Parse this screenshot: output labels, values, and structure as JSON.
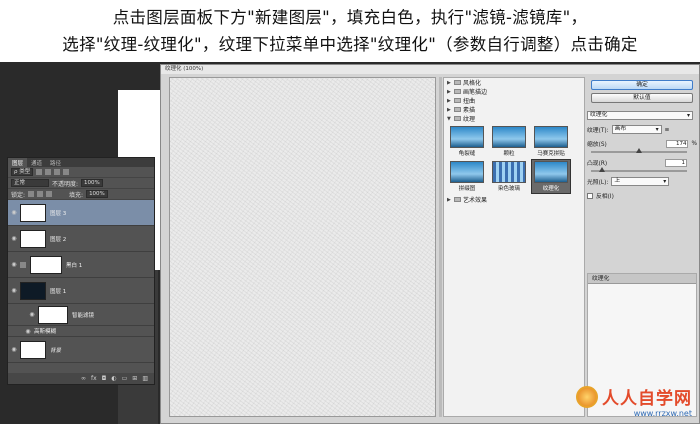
{
  "caption": {
    "line1": "点击图层面板下方\"新建图层\"，填充白色，执行\"滤镜-滤镜库\"，",
    "line2": "选择\"纹理-纹理化\"，纹理下拉菜单中选择\"纹理化\"（参数自行调整）点击确定"
  },
  "layers_panel": {
    "tabs": [
      "图层",
      "通道",
      "路径"
    ],
    "filter_kind": "ρ 类型",
    "blend_mode": "正常",
    "opacity_label": "不透明度:",
    "opacity_value": "100%",
    "lock_label": "锁定:",
    "fill_label": "填充:",
    "fill_value": "100%",
    "layers": [
      {
        "name": "图层 3",
        "selected": true,
        "thumb": "white"
      },
      {
        "name": "图层 2",
        "selected": false,
        "thumb": "white"
      },
      {
        "name": "黑白 1",
        "selected": false,
        "thumb": "mask"
      },
      {
        "name": "图层 1",
        "selected": false,
        "thumb": "dark"
      },
      {
        "name": "智能滤镜",
        "selected": false,
        "thumb": "white"
      },
      {
        "name": "高斯模糊",
        "selected": false,
        "thumb": "none"
      },
      {
        "name": "背景",
        "selected": false,
        "thumb": "white"
      }
    ],
    "footer_icons": [
      "link-icon",
      "fx-icon",
      "mask-icon",
      "adjustment-icon",
      "group-icon",
      "new-layer-icon",
      "trash-icon"
    ]
  },
  "dialog": {
    "title": "纹理化 (100%)",
    "categories": [
      "风格化",
      "画笔描边",
      "扭曲",
      "素描",
      "纹理",
      "艺术效果"
    ],
    "texture_filters": [
      "龟裂缝",
      "颗粒",
      "马赛克拼贴",
      "拼缀图",
      "染色玻璃",
      "纹理化"
    ],
    "selected_filter": "纹理化",
    "ok_button": "确定",
    "cancel_button": "默认值",
    "filter_select": "纹理化",
    "texture_label": "纹理(T):",
    "texture_value": "画布",
    "scaling_label": "缩放(S)",
    "scaling_value": "174",
    "scaling_unit": "%",
    "relief_label": "凸现(R)",
    "relief_value": "1",
    "light_label": "光照(L):",
    "light_value": "上",
    "invert_label": "反相(I)",
    "effect_layer": "纹理化"
  },
  "watermark": {
    "brand": "人人自学网",
    "url": "www.rrzxw.net"
  },
  "colors": {
    "selected_layer": "#7b8ea8",
    "panel_bg": "#535353",
    "accent_button": "#3f7cc9"
  }
}
